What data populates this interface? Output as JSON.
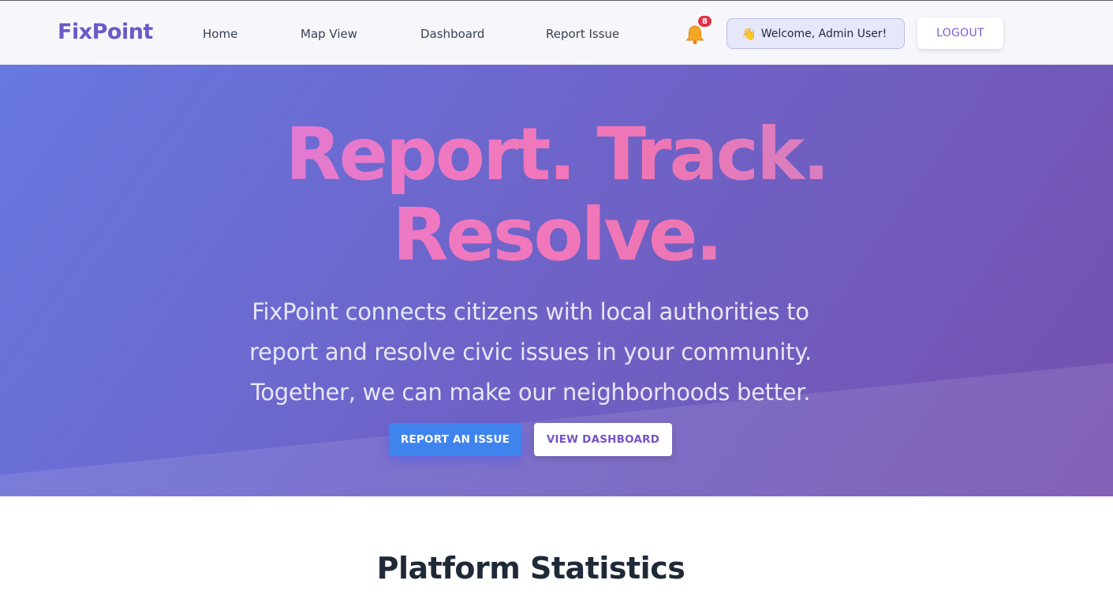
{
  "brand": "FixPoint",
  "nav": {
    "home": "Home",
    "map_view": "Map View",
    "dashboard": "Dashboard",
    "report_issue": "Report Issue"
  },
  "notifications": {
    "count": "8",
    "icon": "bell-icon"
  },
  "user": {
    "wave_icon": "👋",
    "welcome": "Welcome, Admin User!"
  },
  "logout_label": "LOGOUT",
  "hero": {
    "headline_line1": "Report. Track.",
    "headline_line2": "Resolve.",
    "subtext": "FixPoint connects citizens with local authorities to report and resolve civic issues in your community. Together, we can make our neighborhoods better.",
    "primary_button": "REPORT AN ISSUE",
    "secondary_button": "VIEW DASHBOARD"
  },
  "stats_section": {
    "title": "Platform Statistics"
  },
  "colors": {
    "brand": "#6a5bc8",
    "primary_button": "#3f84ee",
    "badge": "#e0314b",
    "hero_start": "#6778e0",
    "hero_end": "#7450ae"
  }
}
